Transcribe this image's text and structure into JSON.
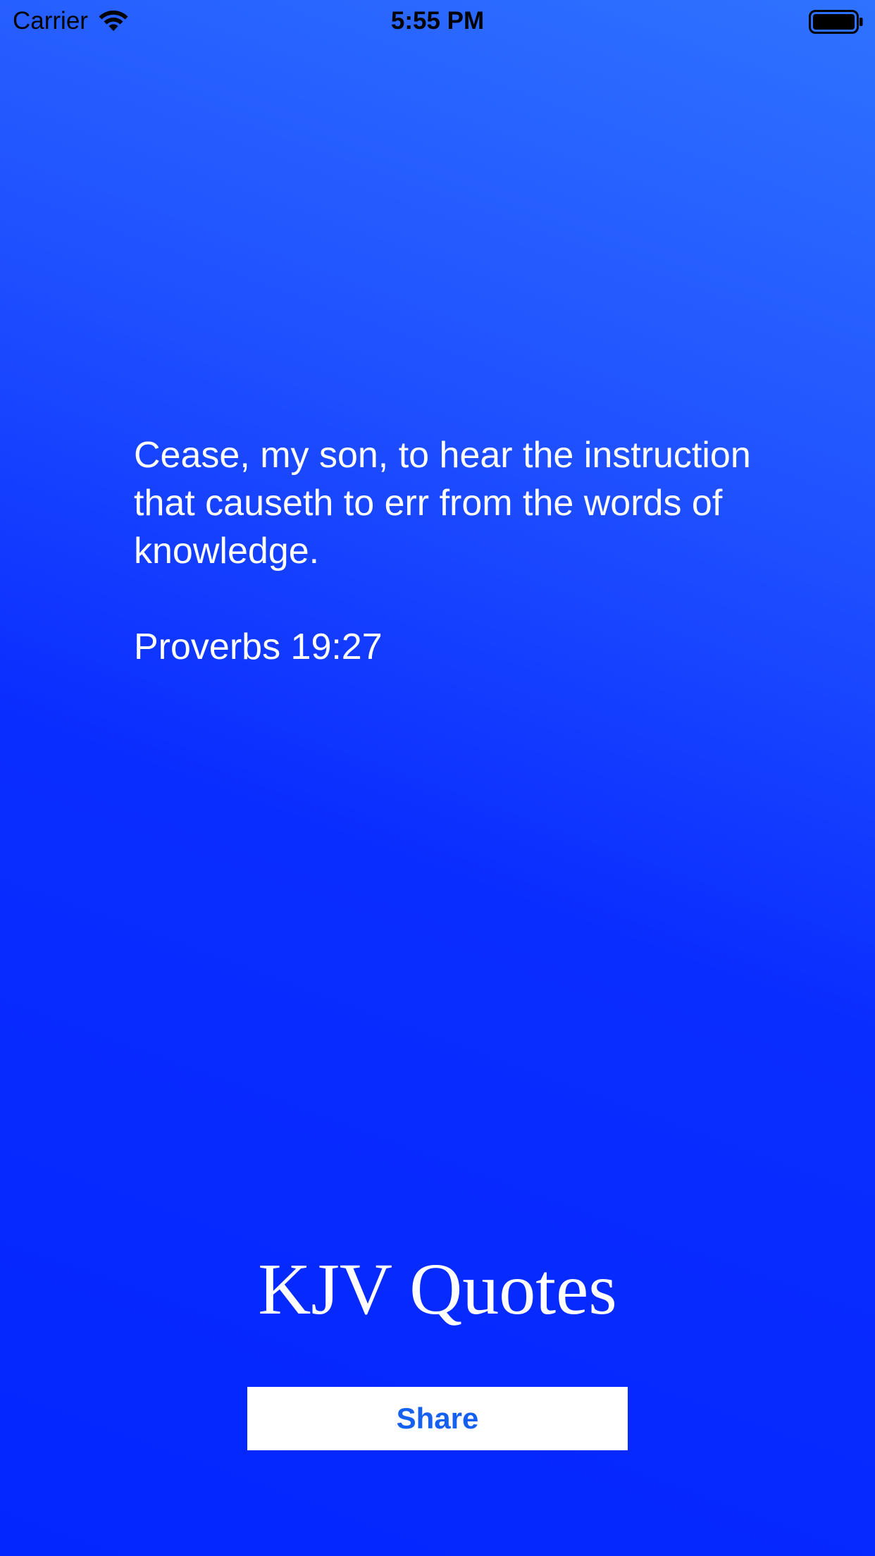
{
  "status_bar": {
    "carrier": "Carrier",
    "time": "5:55 PM",
    "icons": [
      "wifi-icon",
      "battery-icon"
    ]
  },
  "quote": {
    "text": "Cease, my son, to hear the instruction that causeth to err from the words of knowledge.",
    "reference": "Proverbs 19:27"
  },
  "app": {
    "title": "KJV Quotes"
  },
  "actions": {
    "share_label": "Share"
  },
  "colors": {
    "background_top": "#2f72ff",
    "background_bottom": "#0326ff",
    "text": "#ffffff",
    "share_label": "#1560ee"
  }
}
